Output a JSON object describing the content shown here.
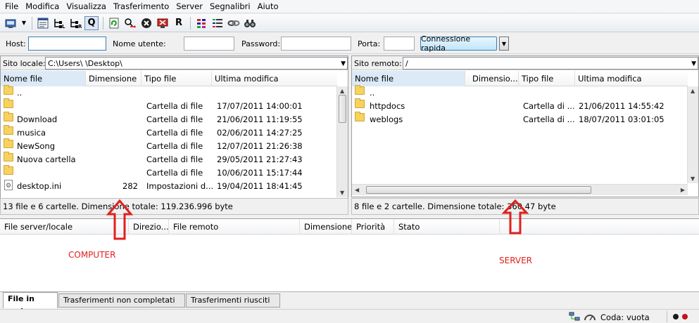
{
  "menu": [
    "File",
    "Modifica",
    "Visualizza",
    "Trasferimento",
    "Server",
    "Segnalibri",
    "Aiuto"
  ],
  "toolbar": {
    "icons": [
      "site-manager-icon",
      "dropdown-icon",
      "message-log-icon",
      "local-tree-icon",
      "remote-tree-icon",
      "queue-icon",
      "refresh-icon",
      "process-queue-icon",
      "cancel-icon",
      "disconnect-icon",
      "reconnect-icon",
      "compare-icon",
      "sync-browse-icon",
      "link-icon",
      "find-icon"
    ],
    "queue_glyph": "Q",
    "reconnect_glyph": "R"
  },
  "quickconnect": {
    "host_label": "Host:",
    "host_value": "",
    "user_label": "Nome utente:",
    "user_value": "",
    "password_label": "Password:",
    "password_value": "",
    "port_label": "Porta:",
    "port_value": "",
    "connect_label": "Connessione rapida"
  },
  "local": {
    "site_label": "Sito locale:",
    "path_value": "C:\\Users\\          \\Desktop\\",
    "columns": [
      "Nome file",
      "Dimensione",
      "Tipo file",
      "Ultima modifica"
    ],
    "rows": [
      {
        "name": "..",
        "size": "",
        "type": "",
        "modified": "",
        "icon": "folder"
      },
      {
        "name": "",
        "size": "",
        "type": "Cartella di file",
        "modified": "17/07/2011 14:00:01",
        "icon": "folder"
      },
      {
        "name": "Download",
        "size": "",
        "type": "Cartella di file",
        "modified": "21/06/2011 11:19:55",
        "icon": "folder"
      },
      {
        "name": "musica",
        "size": "",
        "type": "Cartella di file",
        "modified": "02/06/2011 14:27:25",
        "icon": "folder"
      },
      {
        "name": "NewSong",
        "size": "",
        "type": "Cartella di file",
        "modified": "12/07/2011 21:26:38",
        "icon": "folder"
      },
      {
        "name": "Nuova cartella",
        "size": "",
        "type": "Cartella di file",
        "modified": "29/05/2011 21:27:43",
        "icon": "folder"
      },
      {
        "name": "",
        "size": "",
        "type": "Cartella di file",
        "modified": "10/06/2011 15:17:44",
        "icon": "folder"
      },
      {
        "name": "desktop.ini",
        "size": "282",
        "type": "Impostazioni d...",
        "modified": "19/04/2011 18:41:45",
        "icon": "file"
      }
    ],
    "status": "13 file e 6 cartelle. Dimensione totale: 119.236.996 byte"
  },
  "remote": {
    "site_label": "Sito remoto:",
    "path_value": "/",
    "columns": [
      "Nome file",
      "Dimensio...",
      "Tipo file",
      "Ultima modifica"
    ],
    "rows": [
      {
        "name": "..",
        "size": "",
        "type": "",
        "modified": "",
        "icon": "folder"
      },
      {
        "name": "httpdocs",
        "size": "",
        "type": "Cartella di ...",
        "modified": "21/06/2011 14:55:42",
        "icon": "folder"
      },
      {
        "name": "weblogs",
        "size": "",
        "type": "Cartella di ...",
        "modified": "18/07/2011 03:01:05",
        "icon": "folder"
      }
    ],
    "status": "8 file e 2 cartelle. Dimensione totale: 360.47  byte"
  },
  "queue": {
    "columns": [
      "File server/locale",
      "Direzio...",
      "File remoto",
      "Dimensione",
      "Priorità",
      "Stato"
    ]
  },
  "annotations": {
    "computer_label": "COMPUTER",
    "server_label": "SERVER",
    "arrow_color": "#e0201c"
  },
  "tabs": [
    "File in coda",
    "Trasferimenti non completati",
    "Trasferimenti riusciti"
  ],
  "statusbar": {
    "queue_text": "Coda: vuota"
  }
}
